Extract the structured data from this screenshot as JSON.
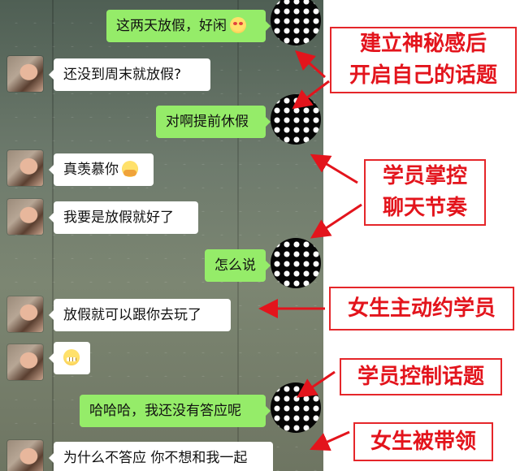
{
  "messages": [
    {
      "from": "me",
      "text": "这两天放假，好闲",
      "emoji": "smile-emoji"
    },
    {
      "from": "her",
      "text": "还没到周末就放假?"
    },
    {
      "from": "me",
      "text": "对啊提前休假"
    },
    {
      "from": "her",
      "text": "真羡慕你",
      "emoji": "hands-emoji"
    },
    {
      "from": "her",
      "text": "我要是放假就好了"
    },
    {
      "from": "me",
      "text": "怎么说"
    },
    {
      "from": "her",
      "text": "放假就可以跟你去玩了"
    },
    {
      "from": "her",
      "text": "",
      "emoji": "grimace-emoji"
    },
    {
      "from": "me",
      "text": "哈哈哈，我还没有答应呢"
    },
    {
      "from": "her",
      "text": "为什么不答应 你不想和我一起"
    }
  ],
  "annotations": [
    {
      "lines": [
        "建立神秘感后",
        "开启自己的话题"
      ]
    },
    {
      "lines": [
        "学员掌控",
        "聊天节奏"
      ]
    },
    {
      "lines": [
        "女生主动约学员"
      ]
    },
    {
      "lines": [
        "学员控制话题"
      ]
    },
    {
      "lines": [
        "女生被带领"
      ]
    }
  ],
  "colors": {
    "annotation_red": "#e3141c",
    "my_bubble": "#95ec69",
    "her_bubble": "#ffffff"
  }
}
